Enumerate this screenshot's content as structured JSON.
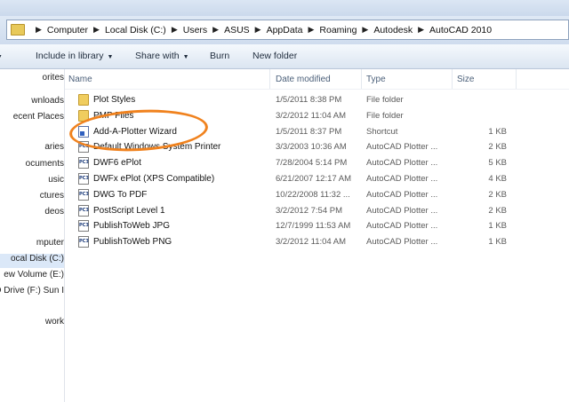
{
  "address_bar": {
    "crumbs": [
      "Computer",
      "Local Disk (C:)",
      "Users",
      "ASUS",
      "AppData",
      "Roaming",
      "Autodesk",
      "AutoCAD 2010"
    ]
  },
  "toolbar": {
    "include_label": "Include in library",
    "share_label": "Share with",
    "burn_label": "Burn",
    "new_folder_label": "New folder"
  },
  "nav": {
    "items": [
      "orites",
      "wnloads",
      "ecent Places",
      "aries",
      "ocuments",
      "usic",
      "ctures",
      "deos",
      "mputer",
      "ocal Disk (C:)",
      "ew Volume (E:)",
      "D Drive (F:) Sun I",
      "work"
    ],
    "selected_index": 9
  },
  "columns": {
    "name": "Name",
    "date": "Date modified",
    "type": "Type",
    "size": "Size"
  },
  "files": [
    {
      "name": "Plot Styles",
      "date": "1/5/2011 8:38 PM",
      "type": "File folder",
      "size": "",
      "icon": "folder-icon"
    },
    {
      "name": "PMP Files",
      "date": "3/2/2012 11:04 AM",
      "type": "File folder",
      "size": "",
      "icon": "folder-icon"
    },
    {
      "name": "Add-A-Plotter Wizard",
      "date": "1/5/2011 8:37 PM",
      "type": "Shortcut",
      "size": "1 KB",
      "icon": "shortcut-icon"
    },
    {
      "name": "Default Windows System Printer",
      "date": "3/3/2003 10:36 AM",
      "type": "AutoCAD Plotter ...",
      "size": "2 KB",
      "icon": "pc3-file-icon"
    },
    {
      "name": "DWF6 ePlot",
      "date": "7/28/2004 5:14 PM",
      "type": "AutoCAD Plotter ...",
      "size": "5 KB",
      "icon": "pc3-file-icon"
    },
    {
      "name": "DWFx ePlot (XPS Compatible)",
      "date": "6/21/2007 12:17 AM",
      "type": "AutoCAD Plotter ...",
      "size": "4 KB",
      "icon": "pc3-file-icon"
    },
    {
      "name": "DWG To PDF",
      "date": "10/22/2008 11:32 ...",
      "type": "AutoCAD Plotter ...",
      "size": "2 KB",
      "icon": "pc3-file-icon"
    },
    {
      "name": "PostScript Level 1",
      "date": "3/2/2012 7:54 PM",
      "type": "AutoCAD Plotter ...",
      "size": "2 KB",
      "icon": "pc3-file-icon"
    },
    {
      "name": "PublishToWeb JPG",
      "date": "12/7/1999 11:53 AM",
      "type": "AutoCAD Plotter ...",
      "size": "1 KB",
      "icon": "pc3-file-icon"
    },
    {
      "name": "PublishToWeb PNG",
      "date": "3/2/2012 11:04 AM",
      "type": "AutoCAD Plotter ...",
      "size": "1 KB",
      "icon": "pc3-file-icon"
    }
  ],
  "highlight_color": "#f0821e",
  "icons": {
    "address_folder": "folder-icon",
    "crumb_separator": "chevron-right-icon",
    "dropdown": "chevron-down-icon"
  }
}
